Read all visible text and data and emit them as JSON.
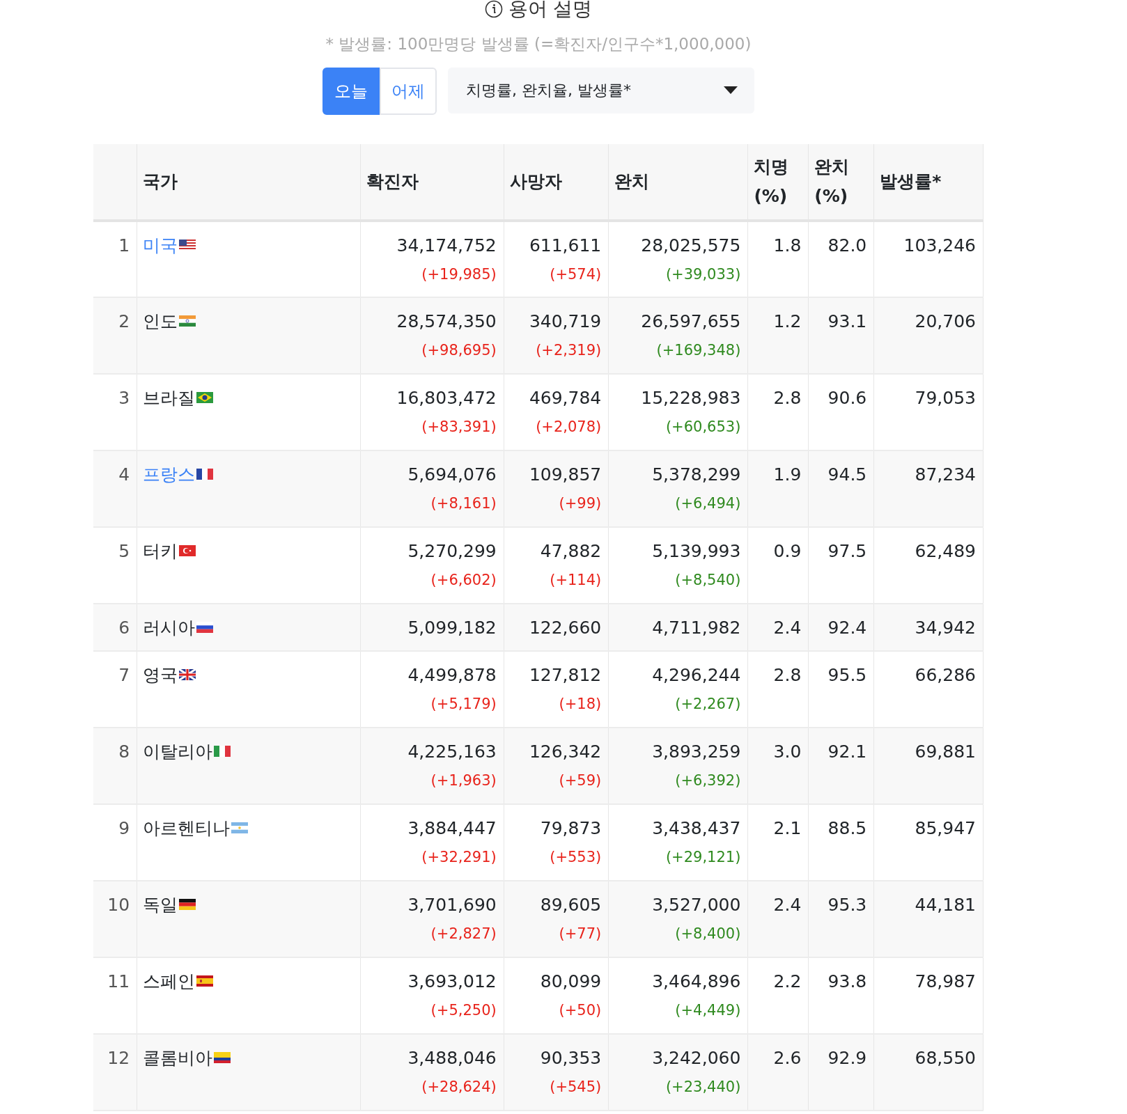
{
  "header": {
    "title": "용어 설명",
    "note": "* 발생률: 100만명당 발생률 (=확진자/인구수*1,000,000)"
  },
  "day_toggle": [
    {
      "label": "오늘",
      "selected": true
    },
    {
      "label": "어제",
      "selected": false
    }
  ],
  "metric_select": {
    "value": "치명률, 완치율, 발생률*"
  },
  "table": {
    "columns": [
      "국가",
      "확진자",
      "사망자",
      "완치",
      "치명 (%)",
      "완치 (%)",
      "발생률*"
    ],
    "rows": [
      {
        "rank": "1",
        "country": "미국",
        "link": true,
        "confirmed": "34,174,752",
        "confirmed_delta": "(+19,985)",
        "deaths": "611,611",
        "deaths_delta": "(+574)",
        "recovered": "28,025,575",
        "recovered_delta": "(+39,033)",
        "fatality": "1.8",
        "recovery": "82.0",
        "incidence": "103,246"
      },
      {
        "rank": "2",
        "country": "인도",
        "link": false,
        "confirmed": "28,574,350",
        "confirmed_delta": "(+98,695)",
        "deaths": "340,719",
        "deaths_delta": "(+2,319)",
        "recovered": "26,597,655",
        "recovered_delta": "(+169,348)",
        "fatality": "1.2",
        "recovery": "93.1",
        "incidence": "20,706"
      },
      {
        "rank": "3",
        "country": "브라질",
        "link": false,
        "confirmed": "16,803,472",
        "confirmed_delta": "(+83,391)",
        "deaths": "469,784",
        "deaths_delta": "(+2,078)",
        "recovered": "15,228,983",
        "recovered_delta": "(+60,653)",
        "fatality": "2.8",
        "recovery": "90.6",
        "incidence": "79,053"
      },
      {
        "rank": "4",
        "country": "프랑스",
        "link": true,
        "confirmed": "5,694,076",
        "confirmed_delta": "(+8,161)",
        "deaths": "109,857",
        "deaths_delta": "(+99)",
        "recovered": "5,378,299",
        "recovered_delta": "(+6,494)",
        "fatality": "1.9",
        "recovery": "94.5",
        "incidence": "87,234"
      },
      {
        "rank": "5",
        "country": "터키",
        "link": false,
        "confirmed": "5,270,299",
        "confirmed_delta": "(+6,602)",
        "deaths": "47,882",
        "deaths_delta": "(+114)",
        "recovered": "5,139,993",
        "recovered_delta": "(+8,540)",
        "fatality": "0.9",
        "recovery": "97.5",
        "incidence": "62,489"
      },
      {
        "rank": "6",
        "country": "러시아",
        "link": false,
        "confirmed": "5,099,182",
        "deaths": "122,660",
        "recovered": "4,711,982",
        "fatality": "2.4",
        "recovery": "92.4",
        "incidence": "34,942"
      },
      {
        "rank": "7",
        "country": "영국",
        "link": false,
        "confirmed": "4,499,878",
        "confirmed_delta": "(+5,179)",
        "deaths": "127,812",
        "deaths_delta": "(+18)",
        "recovered": "4,296,244",
        "recovered_delta": "(+2,267)",
        "fatality": "2.8",
        "recovery": "95.5",
        "incidence": "66,286"
      },
      {
        "rank": "8",
        "country": "이탈리아",
        "link": false,
        "confirmed": "4,225,163",
        "confirmed_delta": "(+1,963)",
        "deaths": "126,342",
        "deaths_delta": "(+59)",
        "recovered": "3,893,259",
        "recovered_delta": "(+6,392)",
        "fatality": "3.0",
        "recovery": "92.1",
        "incidence": "69,881"
      },
      {
        "rank": "9",
        "country": "아르헨티나",
        "link": false,
        "confirmed": "3,884,447",
        "confirmed_delta": "(+32,291)",
        "deaths": "79,873",
        "deaths_delta": "(+553)",
        "recovered": "3,438,437",
        "recovered_delta": "(+29,121)",
        "fatality": "2.1",
        "recovery": "88.5",
        "incidence": "85,947"
      },
      {
        "rank": "10",
        "country": "독일",
        "link": false,
        "confirmed": "3,701,690",
        "confirmed_delta": "(+2,827)",
        "deaths": "89,605",
        "deaths_delta": "(+77)",
        "recovered": "3,527,000",
        "recovered_delta": "(+8,400)",
        "fatality": "2.4",
        "recovery": "95.3",
        "incidence": "44,181"
      },
      {
        "rank": "11",
        "country": "스페인",
        "link": false,
        "confirmed": "3,693,012",
        "confirmed_delta": "(+5,250)",
        "deaths": "80,099",
        "deaths_delta": "(+50)",
        "recovered": "3,464,896",
        "recovered_delta": "(+4,449)",
        "fatality": "2.2",
        "recovery": "93.8",
        "incidence": "78,987"
      },
      {
        "rank": "12",
        "country": "콜롬비아",
        "link": false,
        "confirmed": "3,488,046",
        "confirmed_delta": "(+28,624)",
        "deaths": "90,353",
        "deaths_delta": "(+545)",
        "recovered": "3,242,060",
        "recovered_delta": "(+23,440)",
        "fatality": "2.6",
        "recovery": "92.9",
        "incidence": "68,550"
      }
    ]
  }
}
